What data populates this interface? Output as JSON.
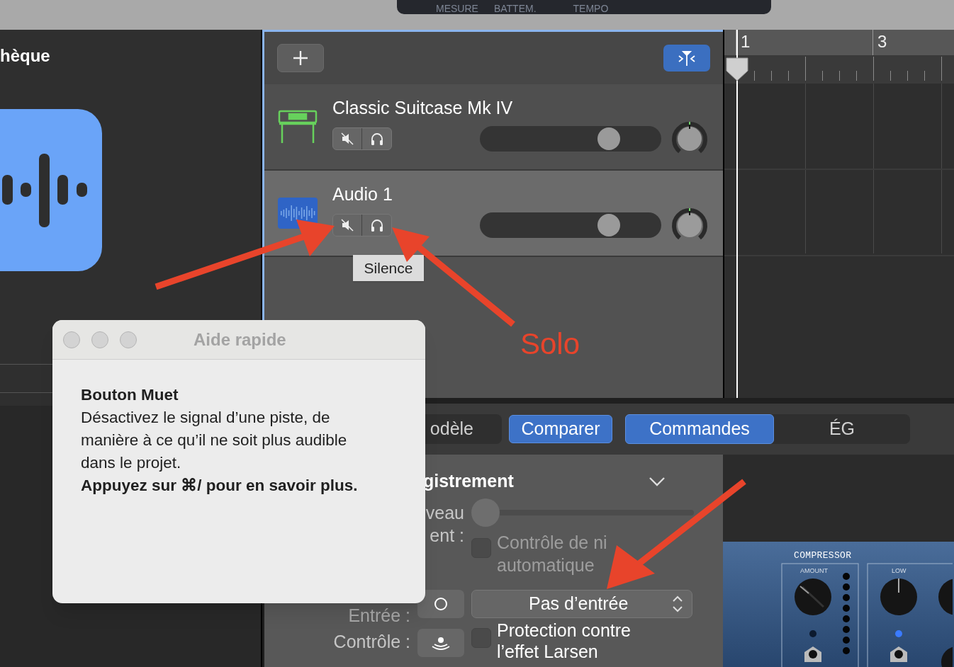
{
  "top_bar": {
    "lcd_labels": [
      "MESURE",
      "BATTEM.",
      "TEMPO"
    ]
  },
  "library": {
    "title": "hèque"
  },
  "tracks": [
    {
      "kind": "instrument",
      "name": "Classic Suitcase Mk IV",
      "selected": false,
      "muted": false,
      "solo": false,
      "level": 0.71
    },
    {
      "kind": "audio",
      "name": "Audio 1",
      "selected": true,
      "muted": false,
      "solo": false,
      "level": 0.71
    }
  ],
  "ruler": {
    "marks": [
      "1",
      "3"
    ]
  },
  "tooltip": "Silence",
  "annotation": "Solo",
  "help_window": {
    "title": "Aide rapide",
    "heading": "Bouton Muet",
    "body": "Désactivez le signal d’une piste, de manière à ce qu’il ne soit plus audible dans le projet.",
    "hint": "Appuyez sur ⌘/ pour en savoir plus."
  },
  "smart_controls": {
    "tabs": [
      {
        "label": "odèle",
        "selected": false
      },
      {
        "label": "Commandes",
        "selected": true
      },
      {
        "label": "ÉG",
        "selected": false
      }
    ],
    "compare_button": "Comparer",
    "section": {
      "title": "gistrement",
      "expanded": true
    },
    "record_level": {
      "label_lines": [
        "veau",
        "ent :"
      ],
      "level": 0
    },
    "auto_level": {
      "label_lines": [
        "Contrôle de ni",
        "automatique"
      ],
      "checked": false,
      "disabled": true
    },
    "input": {
      "label": "Entrée :",
      "value": "Pas d’entrée"
    },
    "monitor": {
      "label": "Contrôle :",
      "larsen_label": "Protection contre l’effet Larsen",
      "checked": false
    }
  },
  "plugin": {
    "title": "COMPRESSOR",
    "knob_labels": [
      "AMOUNT",
      "LOW"
    ]
  }
}
